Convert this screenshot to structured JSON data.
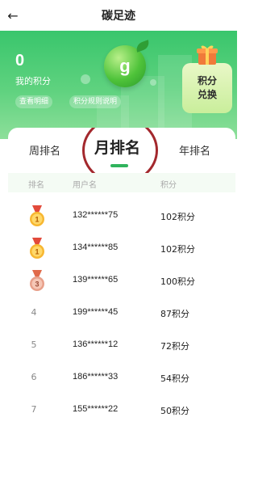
{
  "header": {
    "title": "碳足迹",
    "back_icon": "back-arrow-icon"
  },
  "points": {
    "value": "0",
    "label": "我的积分",
    "detail_button": "查看明细",
    "rules_button": "积分规则说明"
  },
  "mascot": {
    "letter": "g"
  },
  "redeem": {
    "line1": "积分",
    "line2": "兑换",
    "icon": "gift-icon"
  },
  "tabs": {
    "week": "周排名",
    "month": "月排名",
    "year": "年排名"
  },
  "table": {
    "columns": {
      "rank": "排名",
      "user": "用户名",
      "points": "积分"
    },
    "rows": [
      {
        "rank": "1",
        "user": "132******75",
        "points": "102积分",
        "medal": "gold"
      },
      {
        "rank": "1",
        "user": "134******85",
        "points": "102积分",
        "medal": "gold"
      },
      {
        "rank": "3",
        "user": "139******65",
        "points": "100积分",
        "medal": "bronze"
      },
      {
        "rank": "4",
        "user": "199******45",
        "points": "87积分"
      },
      {
        "rank": "5",
        "user": "136******12",
        "points": "72积分"
      },
      {
        "rank": "6",
        "user": "186******33",
        "points": "54积分"
      },
      {
        "rank": "7",
        "user": "155******22",
        "points": "50积分"
      }
    ]
  },
  "colors": {
    "brand_green": "#39c66c",
    "tab_indicator": "#2fb35c",
    "highlight_ring": "#a3282d"
  }
}
